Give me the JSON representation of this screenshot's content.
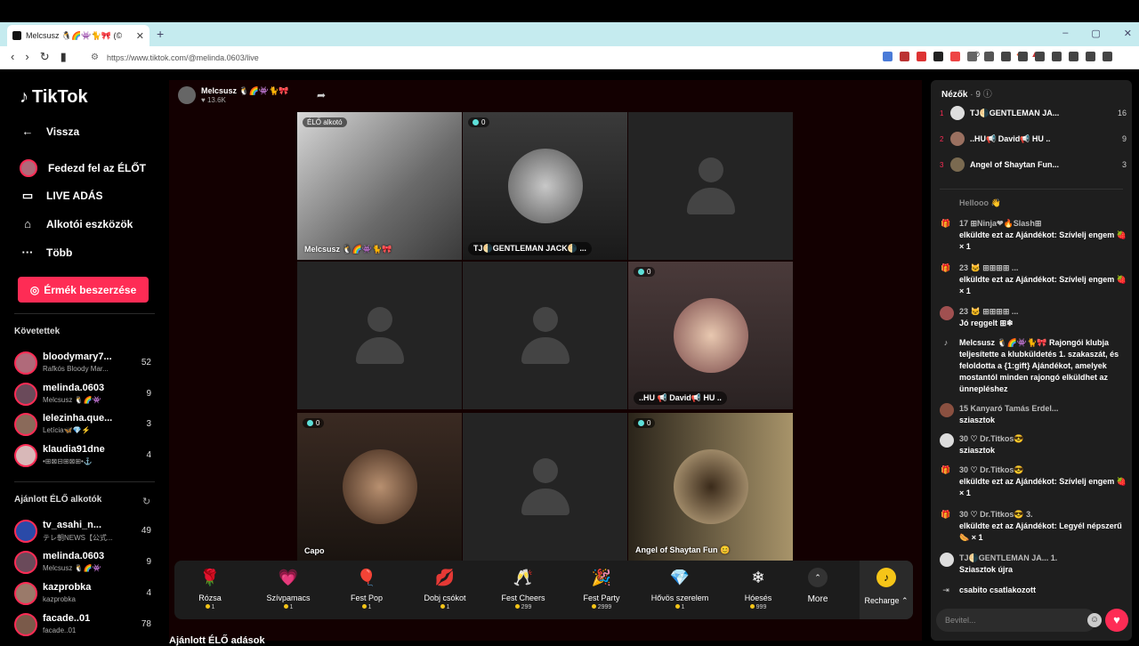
{
  "browser": {
    "tab_title": "Melcsusz 🐧🌈👾🐈🎀 (©",
    "url": "https://www.tiktok.com/@melinda.0603/live",
    "new_tab": "+",
    "win_min": "–",
    "win_max": "▢",
    "win_close": "✕"
  },
  "sidebar": {
    "brand": "TikTok",
    "back": "Vissza",
    "nav": [
      "Fedezd fel az ÉLŐT",
      "LIVE ADÁS",
      "Alkotói eszközök",
      "Több"
    ],
    "coins_button": "Érmék beszerzése",
    "following_header": "Követettek",
    "following": [
      {
        "name": "bloodymary7...",
        "sub": "Rafkós Bloody Mar...",
        "count": "52"
      },
      {
        "name": "melinda.0603",
        "sub": "Melcsusz 🐧🌈👾",
        "count": "9"
      },
      {
        "name": "lelezinha.que...",
        "sub": "Letícia🦋💎⚡",
        "count": "3"
      },
      {
        "name": "klaudia91dne",
        "sub": "•⊞⊠⊟⊞⊠⊞•⚓",
        "count": "4"
      }
    ],
    "recommended_header": "Ajánlott ÉLŐ alkotók",
    "recommended": [
      {
        "name": "tv_asahi_n...",
        "sub": "テレ朝NEWS【公式...",
        "count": "49"
      },
      {
        "name": "melinda.0603",
        "sub": "Melcsusz 🐧🌈👾",
        "count": "9"
      },
      {
        "name": "kazprobka",
        "sub": "kazprobka",
        "count": "4"
      },
      {
        "name": "facade..01",
        "sub": "facade..01",
        "count": "78"
      }
    ]
  },
  "stream": {
    "host_name": "Melcsusz 🐧🌈👾🐈🎀",
    "likes": "♥ 13.6K",
    "bottom_heading": "Ajánlott ÉLŐ adások",
    "cells": [
      {
        "badge": "ÉLŐ alkotó",
        "label": "Melcsusz 🐧🌈👾🐈🎀"
      },
      {
        "badge": "0",
        "label": "TJ🌗GENTLEMAN JACK🌗 ..."
      },
      {
        "badge": "",
        "label": ""
      },
      {
        "badge": "",
        "label": ""
      },
      {
        "badge": "",
        "label": ""
      },
      {
        "badge": "0",
        "label": "..HU 📢 David📢 HU .."
      },
      {
        "badge": "0",
        "label": "Capo"
      },
      {
        "badge": "",
        "label": ""
      },
      {
        "badge": "0",
        "label": "Angel of Shaytan Fun 😊"
      }
    ]
  },
  "gifts": [
    {
      "name": "Rózsa",
      "price": "1",
      "icon": "🌹"
    },
    {
      "name": "Szívpamacs",
      "price": "1",
      "icon": "💗"
    },
    {
      "name": "Fest Pop",
      "price": "1",
      "icon": "🎈"
    },
    {
      "name": "Dobj csókot",
      "price": "1",
      "icon": "💋"
    },
    {
      "name": "Fest Cheers",
      "price": "299",
      "icon": "🥂"
    },
    {
      "name": "Fest Party",
      "price": "2999",
      "icon": "🎉"
    },
    {
      "name": "Hővös szerelem",
      "price": "1",
      "icon": "💎"
    },
    {
      "name": "Hóesés",
      "price": "999",
      "icon": "❄"
    }
  ],
  "gift_more": "More",
  "recharge": "Recharge ⌃",
  "viewers": {
    "title": "Nézők",
    "count": "· 9",
    "list": [
      {
        "rank": "1",
        "name": "TJ🌗GENTLEMAN JA...",
        "score": "16"
      },
      {
        "rank": "2",
        "name": "..HU📢 David📢 HU ..",
        "score": "9"
      },
      {
        "rank": "3",
        "name": "Angel of Shaytan Fun...",
        "score": "3"
      }
    ]
  },
  "chat": [
    {
      "type": "text",
      "header": "",
      "text": "Hellooo 👋"
    },
    {
      "type": "gift",
      "header": "17 ⊞Ninja❤🔥Slash⊞",
      "text": "elküldte ezt az Ajándékot: Szívlelj engem 🍓 × 1"
    },
    {
      "type": "gift",
      "header": "23 🐱 ⊞⊞⊞⊞ ...",
      "text": "elküldte ezt az Ajándékot: Szívlelj engem 🍓 × 1"
    },
    {
      "type": "user",
      "header": "23 🐱 ⊞⊞⊞⊞ ...",
      "text": "Jó reggelt ⊞❄"
    },
    {
      "type": "system",
      "header": "",
      "text": "Melcsusz 🐧🌈👾🐈🎀 Rajongói klubja teljesítette a klubküldetés 1. szakaszát, és feloldotta a {1:gift} Ajándékot, amelyek mostantól minden rajongó elküldhet az ünnepléshez"
    },
    {
      "type": "user",
      "header": "15 Kanyaró Tamás Erdel...",
      "text": "sziasztok"
    },
    {
      "type": "user",
      "header": "30 ♡ Dr.Titkos😎",
      "text": "sziasztok"
    },
    {
      "type": "gift",
      "header": "30 ♡ Dr.Titkos😎",
      "text": "elküldte ezt az Ajándékot: Szívlelj engem 🍓 × 1"
    },
    {
      "type": "gift",
      "header": "30 ♡ Dr.Titkos😎 3.",
      "text": "elküldte ezt az Ajándékot: Legyél népszerű 🌭 × 1"
    },
    {
      "type": "user",
      "header": "TJ🌗GENTLEMAN JA... 1.",
      "text": "Sziasztok újra"
    },
    {
      "type": "join",
      "header": "",
      "text": "csabito  csatlakozott"
    }
  ],
  "chat_input": {
    "placeholder": "Bevitel..."
  },
  "colors": {
    "accent": "#fe2c55",
    "stage_bg": "#130001",
    "panel_bg": "#1e1e1e"
  }
}
